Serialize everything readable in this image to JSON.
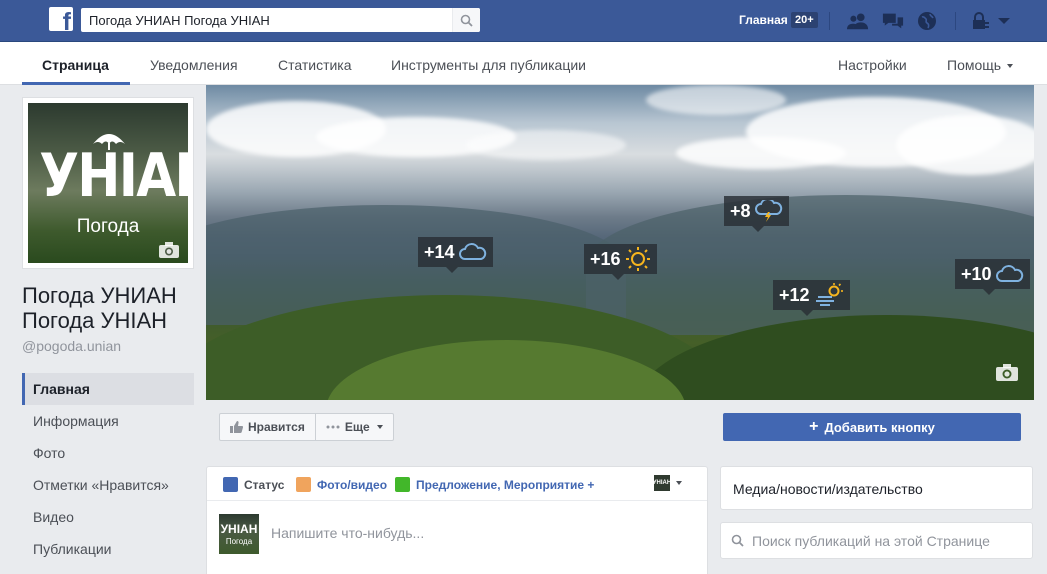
{
  "topbar": {
    "logo": "f",
    "search_value": "Погода УНИАН Погода УНIАН",
    "home_label": "Главная",
    "home_badge": "20+",
    "icons": [
      "friend-requests-icon",
      "messages-icon",
      "notifications-globe-icon",
      "privacy-lock-icon",
      "account-menu-caret-icon"
    ]
  },
  "page_nav": {
    "tabs": [
      {
        "label": "Страница",
        "active": true
      },
      {
        "label": "Уведомления"
      },
      {
        "label": "Статистика"
      },
      {
        "label": "Инструменты для публикации"
      }
    ],
    "settings_label": "Настройки",
    "help_label": "Помощь"
  },
  "profile": {
    "brand": "УНIАН",
    "sub": "Погода",
    "name": "Погода УНИАН Погода УНIАН",
    "handle": "@pogoda.unian"
  },
  "left_nav": {
    "items": [
      {
        "label": "Главная",
        "active": true
      },
      {
        "label": "Информация"
      },
      {
        "label": "Фото"
      },
      {
        "label": "Отметки «Нравится»"
      },
      {
        "label": "Видео"
      },
      {
        "label": "Публикации"
      }
    ]
  },
  "cover": {
    "weather_tags": [
      {
        "temp": "+14",
        "icon": "cloud-icon"
      },
      {
        "temp": "+16",
        "icon": "sun-icon"
      },
      {
        "temp": "+8",
        "icon": "thunderstorm-cloud-icon"
      },
      {
        "temp": "+12",
        "icon": "partly-cloudy-wind-icon"
      },
      {
        "temp": "+10",
        "icon": "cloud-icon"
      }
    ]
  },
  "actions": {
    "like_label": "Нравится",
    "more_label": "Еще",
    "add_button_label": "Добавить кнопку"
  },
  "composer": {
    "tab_status": "Статус",
    "tab_photo": "Фото/видео",
    "tab_offer": "Предложение, Мероприятие +",
    "placeholder": "Напишите что-нибудь...",
    "avatar_brand": "УНIАН",
    "avatar_sub": "Погода"
  },
  "right": {
    "category": "Медиа/новости/издательство",
    "search_placeholder": "Поиск публикаций на этой Странице"
  },
  "colors": {
    "fb_blue": "#3b5998",
    "accent": "#4267b2",
    "background": "#e9ebee"
  }
}
